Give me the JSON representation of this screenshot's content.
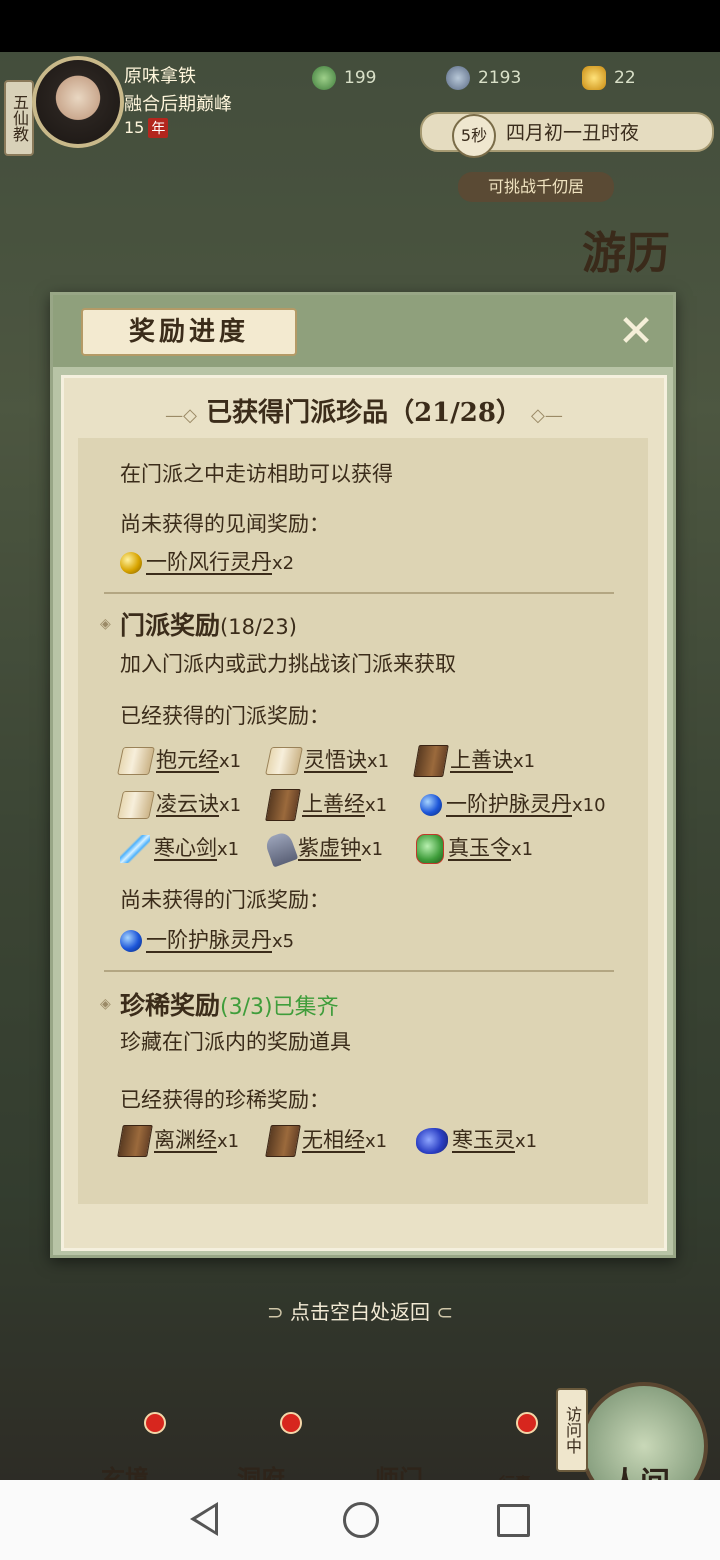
{
  "player": {
    "sect_tag": "五仙教",
    "name": "原味拿铁",
    "realm": "融合后期巅峰",
    "age": "15",
    "age_unit": "年"
  },
  "resources": [
    {
      "icon": "jade-swirl-icon",
      "value": "199"
    },
    {
      "icon": "coin-icon",
      "value": "2193"
    },
    {
      "icon": "gold-ingot-icon",
      "value": "22"
    }
  ],
  "timer": {
    "seconds": "5秒",
    "date": "四月初一丑时夜"
  },
  "challenge_label": "可挑战千仞居",
  "youli_label": "游历",
  "dialog": {
    "title": "奖励进度",
    "subtitle": "已获得门派珍品（21/28）",
    "intro": "在门派之中走访相助可以获得",
    "pending_jianwen_label": "尚未获得的见闻奖励：",
    "pending_jianwen_items": [
      {
        "icon": "gold-pill-icon",
        "name": "一阶风行灵丹",
        "qty": "x2"
      }
    ],
    "sect_section": {
      "title": "门派奖励",
      "count": "(18/23)",
      "desc": "加入门派内或武力挑战该门派来获取",
      "obtained_label": "已经获得的门派奖励：",
      "obtained_items": [
        {
          "icon": "scroll-icon",
          "name": "抱元经",
          "qty": "x1"
        },
        {
          "icon": "scroll-icon",
          "name": "灵悟诀",
          "qty": "x1"
        },
        {
          "icon": "book-icon",
          "name": "上善诀",
          "qty": "x1"
        },
        {
          "icon": "scroll-icon",
          "name": "凌云诀",
          "qty": "x1"
        },
        {
          "icon": "book-icon",
          "name": "上善经",
          "qty": "x1"
        },
        {
          "icon": "blue-pill-icon",
          "name": "一阶护脉灵丹",
          "qty": "x10"
        },
        {
          "icon": "sword-icon",
          "name": "寒心剑",
          "qty": "x1"
        },
        {
          "icon": "bell-icon",
          "name": "紫虚钟",
          "qty": "x1"
        },
        {
          "icon": "jade-token-icon",
          "name": "真玉令",
          "qty": "x1"
        }
      ],
      "pending_label": "尚未获得的门派奖励：",
      "pending_items": [
        {
          "icon": "blue-pill-icon",
          "name": "一阶护脉灵丹",
          "qty": "x5"
        }
      ]
    },
    "rare_section": {
      "title": "珍稀奖励",
      "count": "(3/3)",
      "status": "已集齐",
      "desc": "珍藏在门派内的奖励道具",
      "obtained_label": "已经获得的珍稀奖励：",
      "obtained_items": [
        {
          "icon": "book-icon",
          "name": "离渊经",
          "qty": "x1"
        },
        {
          "icon": "book-icon",
          "name": "无相经",
          "qty": "x1"
        },
        {
          "icon": "cloud-jade-icon",
          "name": "寒玉灵",
          "qty": "x1"
        }
      ]
    }
  },
  "back_hint": "点击空白处返回",
  "bottom_nav": [
    {
      "label": "玄境",
      "badge": true
    },
    {
      "label": "洞府",
      "badge": true
    },
    {
      "label": "师门",
      "badge": false
    },
    {
      "label": "行囊",
      "badge": true
    }
  ],
  "renjian": {
    "label": "人间",
    "visiting": "访问中"
  }
}
